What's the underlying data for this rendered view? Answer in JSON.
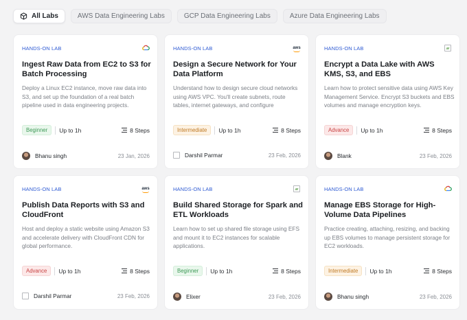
{
  "tabs": [
    {
      "label": "All Labs",
      "active": true
    },
    {
      "label": "AWS Data Engineering Labs",
      "active": false
    },
    {
      "label": "GCP Data Engineering Labs",
      "active": false
    },
    {
      "label": "Azure Data Engineering Labs",
      "active": false
    }
  ],
  "cards": [
    {
      "kicker": "HANDS-ON LAB",
      "provider_icon": "gcp-icon",
      "title": "Ingest Raw Data from EC2 to S3 for Batch Processing",
      "description": "Deploy a Linux EC2 instance, move raw data into S3, and set up the foundation of a real batch pipeline used in data engineering projects.",
      "level": "Beginner",
      "duration": "Up to 1h",
      "steps": "8 Steps",
      "author": "Bhanu singh",
      "date": "23 Jan, 2026"
    },
    {
      "kicker": "HANDS-ON LAB",
      "provider_icon": "aws-icon",
      "title": "Design a Secure Network for Your Data Platform",
      "description": "Understand how to design secure cloud networks using AWS VPC. You'll create subnets, route tables, internet gateways, and configure",
      "level": "Intermediate",
      "duration": "Up to 1h",
      "steps": "8 Steps",
      "author": "Darshil Parmar",
      "date": "23 Feb, 2026"
    },
    {
      "kicker": "HANDS-ON LAB",
      "provider_icon": "broken-image-icon",
      "title": "Encrypt a Data Lake with AWS KMS, S3, and EBS",
      "description": "Learn how to protect sensitive data using AWS Key Management Service. Encrypt S3 buckets and EBS volumes and manage encryption keys.",
      "level": "Advance",
      "duration": "Up to 1h",
      "steps": "8 Steps",
      "author": "Blank",
      "date": "23 Feb, 2026"
    },
    {
      "kicker": "HANDS-ON LAB",
      "provider_icon": "aws-icon",
      "title": "Publish Data Reports with S3 and CloudFront",
      "description": "Host and deploy a static website using Amazon S3 and accelerate delivery with CloudFront CDN for global performance.",
      "level": "Advance",
      "duration": "Up to 1h",
      "steps": "8 Steps",
      "author": "Darshil Parmar",
      "date": "23 Feb, 2026"
    },
    {
      "kicker": "HANDS-ON LAB",
      "provider_icon": "broken-image-icon",
      "title": "Build Shared Storage for Spark and ETL Workloads",
      "description": "Learn how to set up shared file storage using EFS and mount it to EC2 instances for scalable applications.",
      "level": "Beginner",
      "duration": "Up to 1h",
      "steps": "8 Steps",
      "author": "Elixer",
      "date": "23 Feb, 2026"
    },
    {
      "kicker": "HANDS-ON LAB",
      "provider_icon": "gcp-icon",
      "title": "Manage EBS Storage for High-Volume Data Pipelines",
      "description": "Practice creating, attaching, resizing, and backing up EBS volumes to manage persistent storage for EC2 workloads.",
      "level": "Intermediate",
      "duration": "Up to 1h",
      "steps": "8 Steps",
      "author": "Bhanu singh",
      "date": "23 Feb, 2026"
    }
  ],
  "aws_logo_text": "aws",
  "colors": {
    "accent": "#2f5bd3",
    "beginner": "#3f9a58",
    "intermediate": "#c07a24",
    "advance": "#c94444"
  }
}
